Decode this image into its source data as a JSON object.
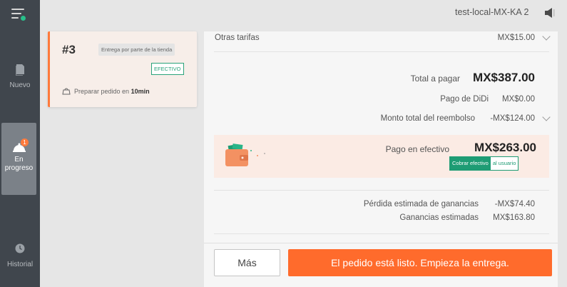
{
  "sidebar": {
    "items": [
      {
        "label": "Nuevo"
      },
      {
        "label_line1": "En",
        "label_line2": "progreso",
        "badge": "1"
      },
      {
        "label": "Historial"
      }
    ]
  },
  "header": {
    "store_name": "test-local-MX-KA 2"
  },
  "order": {
    "number": "#3",
    "delivery_type": "Entrega por parte de la tienda",
    "payment_tag": "EFECTIVO",
    "prep_text": "Preparar pedido en",
    "prep_time": "10min"
  },
  "summary": {
    "other_fees_label": "Otras tarifas",
    "other_fees_value": "MX$15.00",
    "total_label": "Total a pagar",
    "total_value": "MX$387.00",
    "didi_label": "Pago de DiDi",
    "didi_value": "MX$0.00",
    "refund_label": "Monto total del reembolso",
    "refund_value": "-MX$124.00",
    "cash_label": "Pago en efectivo",
    "cash_value": "MX$263.00",
    "collect_part1": "Cobrar efectivo",
    "collect_part2": "al usuario",
    "loss_label": "Pérdida estimada de ganancias",
    "loss_value": "-MX$74.40",
    "earnings_label": "Ganancias estimadas",
    "earnings_value": "MX$163.80"
  },
  "actions": {
    "more_label": "Más",
    "ready_label": "El pedido está listo. Empieza la entrega."
  },
  "colors": {
    "accent": "#ff6b2c",
    "green": "#1e9c74",
    "sidebar": "#40464d"
  },
  "icons": [
    "menu-icon",
    "new-orders-icon",
    "bell-icon",
    "history-icon",
    "speaker-icon",
    "bag-icon",
    "wallet-icon",
    "chevron-down-icon"
  ]
}
